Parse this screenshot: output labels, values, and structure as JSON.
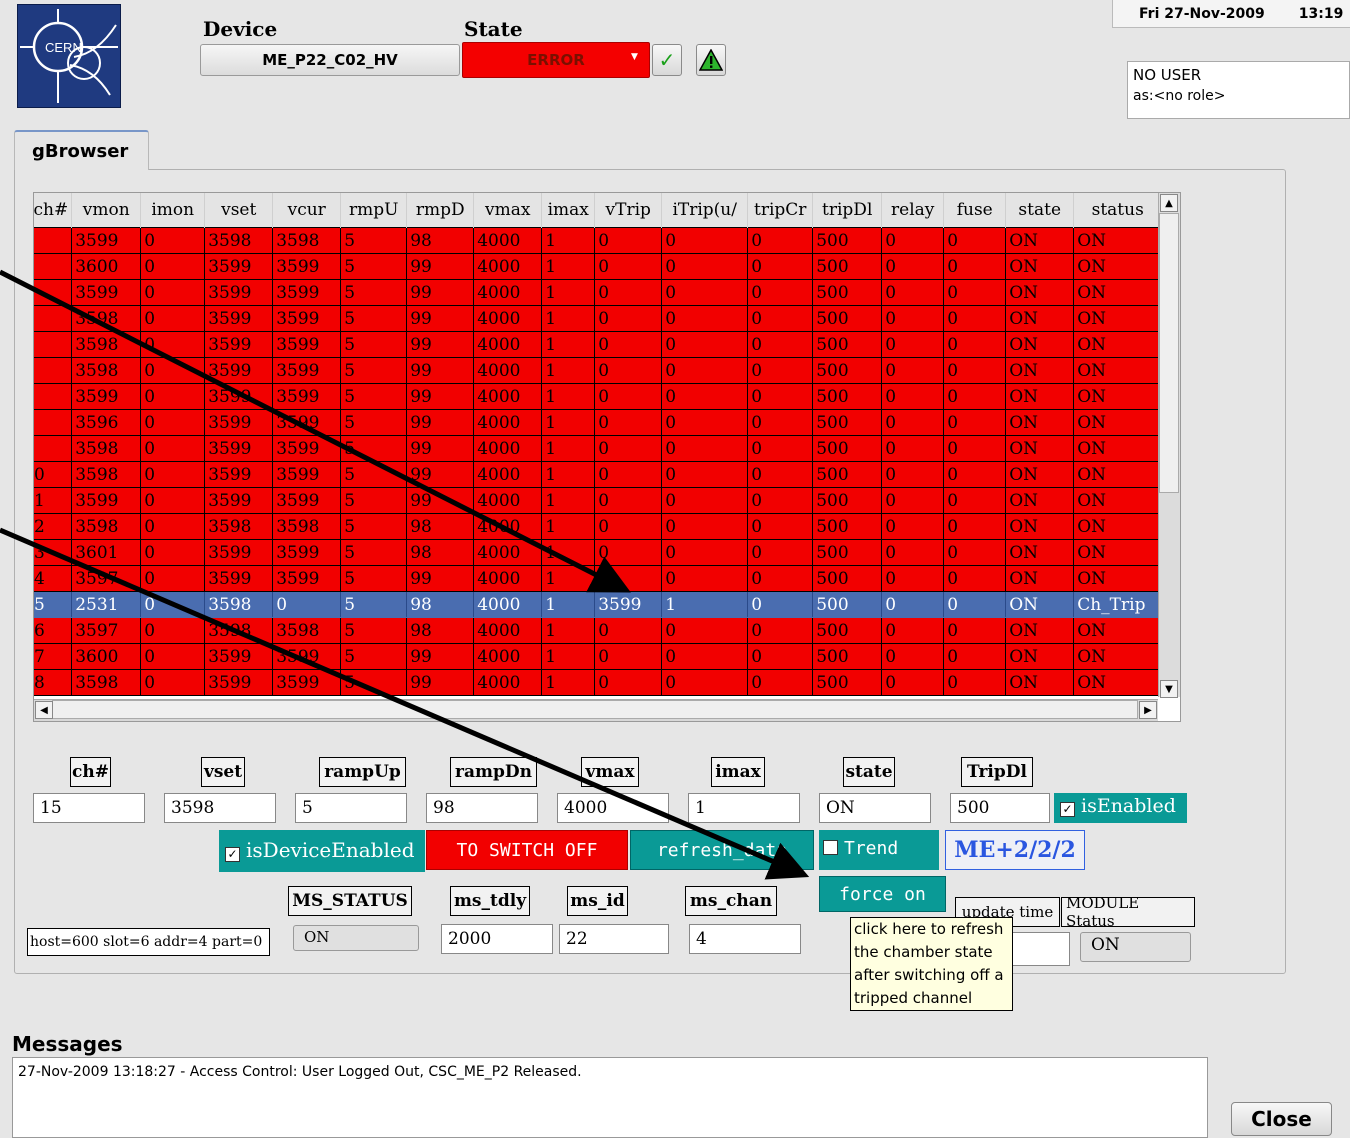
{
  "header": {
    "logo_text": "CERN",
    "device_label": "Device",
    "device_value": "ME_P22_C02_HV",
    "state_label": "State",
    "state_value": "ERROR",
    "date": "Fri 27-Nov-2009",
    "time": "13:19",
    "user": "NO USER",
    "role": "as:<no role>"
  },
  "tab": {
    "label": "gBrowser"
  },
  "table": {
    "columns": [
      "ch#",
      "vmon",
      "imon",
      "vset",
      "vcur",
      "rmpU",
      "rmpD",
      "vmax",
      "imax",
      "vTrip",
      "iTrip(u/",
      "tripCr",
      "tripDl",
      "relay",
      "fuse",
      "state",
      "status"
    ],
    "rows": [
      [
        "",
        "3599",
        "0",
        "3598",
        "3598",
        "5",
        "98",
        "4000",
        "1",
        "0",
        "0",
        "0",
        "500",
        "0",
        "0",
        "ON",
        "ON"
      ],
      [
        "",
        "3600",
        "0",
        "3599",
        "3599",
        "5",
        "99",
        "4000",
        "1",
        "0",
        "0",
        "0",
        "500",
        "0",
        "0",
        "ON",
        "ON"
      ],
      [
        "",
        "3599",
        "0",
        "3599",
        "3599",
        "5",
        "99",
        "4000",
        "1",
        "0",
        "0",
        "0",
        "500",
        "0",
        "0",
        "ON",
        "ON"
      ],
      [
        "",
        "3598",
        "0",
        "3599",
        "3599",
        "5",
        "99",
        "4000",
        "1",
        "0",
        "0",
        "0",
        "500",
        "0",
        "0",
        "ON",
        "ON"
      ],
      [
        "",
        "3598",
        "0",
        "3599",
        "3599",
        "5",
        "99",
        "4000",
        "1",
        "0",
        "0",
        "0",
        "500",
        "0",
        "0",
        "ON",
        "ON"
      ],
      [
        "",
        "3598",
        "0",
        "3599",
        "3599",
        "5",
        "99",
        "4000",
        "1",
        "0",
        "0",
        "0",
        "500",
        "0",
        "0",
        "ON",
        "ON"
      ],
      [
        "",
        "3599",
        "0",
        "3599",
        "3599",
        "5",
        "99",
        "4000",
        "1",
        "0",
        "0",
        "0",
        "500",
        "0",
        "0",
        "ON",
        "ON"
      ],
      [
        "",
        "3596",
        "0",
        "3599",
        "3599",
        "5",
        "99",
        "4000",
        "1",
        "0",
        "0",
        "0",
        "500",
        "0",
        "0",
        "ON",
        "ON"
      ],
      [
        "",
        "3598",
        "0",
        "3599",
        "3599",
        "5",
        "99",
        "4000",
        "1",
        "0",
        "0",
        "0",
        "500",
        "0",
        "0",
        "ON",
        "ON"
      ],
      [
        "0",
        "3598",
        "0",
        "3599",
        "3599",
        "5",
        "99",
        "4000",
        "1",
        "0",
        "0",
        "0",
        "500",
        "0",
        "0",
        "ON",
        "ON"
      ],
      [
        "1",
        "3599",
        "0",
        "3599",
        "3599",
        "5",
        "99",
        "4000",
        "1",
        "0",
        "0",
        "0",
        "500",
        "0",
        "0",
        "ON",
        "ON"
      ],
      [
        "2",
        "3598",
        "0",
        "3598",
        "3598",
        "5",
        "98",
        "4000",
        "1",
        "0",
        "0",
        "0",
        "500",
        "0",
        "0",
        "ON",
        "ON"
      ],
      [
        "3",
        "3601",
        "0",
        "3599",
        "3599",
        "5",
        "98",
        "4000",
        "1",
        "0",
        "0",
        "0",
        "500",
        "0",
        "0",
        "ON",
        "ON"
      ],
      [
        "4",
        "3597",
        "0",
        "3599",
        "3599",
        "5",
        "99",
        "4000",
        "1",
        "0",
        "0",
        "0",
        "500",
        "0",
        "0",
        "ON",
        "ON"
      ],
      [
        "5",
        "2531",
        "0",
        "3598",
        "0",
        "5",
        "98",
        "4000",
        "1",
        "3599",
        "1",
        "0",
        "500",
        "0",
        "0",
        "ON",
        "Ch_Trip"
      ],
      [
        "6",
        "3597",
        "0",
        "3598",
        "3598",
        "5",
        "98",
        "4000",
        "1",
        "0",
        "0",
        "0",
        "500",
        "0",
        "0",
        "ON",
        "ON"
      ],
      [
        "7",
        "3600",
        "0",
        "3599",
        "3599",
        "5",
        "99",
        "4000",
        "1",
        "0",
        "0",
        "0",
        "500",
        "0",
        "0",
        "ON",
        "ON"
      ],
      [
        "8",
        "3598",
        "0",
        "3599",
        "3599",
        "5",
        "99",
        "4000",
        "1",
        "0",
        "0",
        "0",
        "500",
        "0",
        "0",
        "ON",
        "ON"
      ]
    ],
    "selected_row": 14
  },
  "fields": {
    "ch": {
      "label": "ch#",
      "value": "15"
    },
    "vset": {
      "label": "vset",
      "value": "3598"
    },
    "rampUp": {
      "label": "rampUp",
      "value": "5"
    },
    "rampDn": {
      "label": "rampDn",
      "value": "98"
    },
    "vmax": {
      "label": "vmax",
      "value": "4000"
    },
    "imax": {
      "label": "imax",
      "value": "1"
    },
    "state": {
      "label": "state",
      "value": "ON"
    },
    "tripdl": {
      "label": "TripDl",
      "value": "500"
    },
    "isEnabled": "isEnabled"
  },
  "controls": {
    "isDeviceEnabled": "isDeviceEnabled",
    "switch_off": "TO SWITCH OFF",
    "refresh": "refresh_data",
    "trend": "Trend",
    "chamber": "ME+2/2/2",
    "force_on": "force on"
  },
  "status_fields": {
    "host": "host=600 slot=6 addr=4 part=0",
    "ms_status": {
      "label": "MS_STATUS",
      "value": "ON"
    },
    "ms_tdly": {
      "label": "ms_tdly",
      "value": "2000"
    },
    "ms_id": {
      "label": "ms_id",
      "value": "22"
    },
    "ms_chan": {
      "label": "ms_chan",
      "value": "4"
    },
    "update_time_label": "update time",
    "module_status": {
      "label": "MODULE Status",
      "value": "ON"
    }
  },
  "tooltip": {
    "lines": [
      "click here to refresh",
      "the chamber state",
      "after switching off a",
      "tripped channel"
    ]
  },
  "messages": {
    "title": "Messages",
    "lines": [
      "27-Nov-2009 13:18:27 - Access Control: User  Logged Out, CSC_ME_P2 Released."
    ]
  },
  "buttons": {
    "close": "Close"
  },
  "colors": {
    "row_red": "#f20000",
    "selected_blue": "#4a6db0",
    "teal": "#0a9a96",
    "logo_blue": "#1f3a80"
  }
}
